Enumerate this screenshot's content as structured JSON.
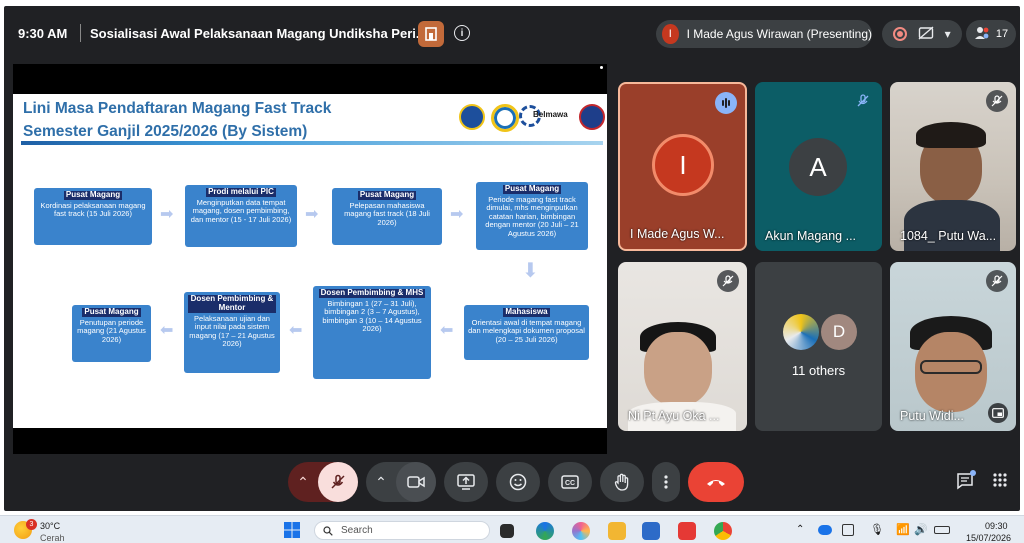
{
  "topbar": {
    "time": "9:30 AM",
    "meeting_title": "Sosialisasi Awal Pelaksanaan Magang Undiksha Peri...",
    "presenter_initial": "I",
    "presenter_label": "I Made Agus Wirawan (Presenting)",
    "people_count": "17"
  },
  "slide": {
    "title_line1": "Lini Masa Pendaftaran Magang Fast Track",
    "title_line2": "Semester Ganjil 2025/2026 (By Sistem)",
    "logo_text": "Belmawa",
    "boxes": [
      {
        "head": "Pusat Magang",
        "body": "Kordinasi pelaksanaan magang fast track (15 Juli 2026)"
      },
      {
        "head": "Prodi melalui PIC",
        "body": "Menginputkan data tempat magang, dosen pembimbing, dan mentor (15 - 17 Juli 2026)"
      },
      {
        "head": "Pusat Magang",
        "body": "Pelepasan mahasiswa magang fast track (18 Juli 2026)"
      },
      {
        "head": "Pusat Magang",
        "body": "Periode magang fast track dimulai, mhs menginputkan catatan harian, bimbingan dengan mentor (20 Juli – 21 Agustus 2026)"
      },
      {
        "head": "Mahasiswa",
        "body": "Orientasi awal di tempat magang dan melengkapi dokumen proposal (20 – 25 Juli 2026)"
      },
      {
        "head": "Dosen Pembimbing & MHS",
        "body": "Bimbingan 1 (27 – 31 Juli), bimbingan 2 (3 – 7 Agustus), bimbingan 3 (10 – 14 Agustus 2026)"
      },
      {
        "head": "Dosen Pembimbing & Mentor",
        "body": "Pelaksanaan ujian dan input nilai pada sistem magang (17 – 21 Agustus 2026)"
      },
      {
        "head": "Pusat Magang",
        "body": "Penutupan periode magang (21 Agustus 2026)"
      }
    ]
  },
  "tiles": [
    {
      "name": "I Made Agus W...",
      "initial": "I"
    },
    {
      "name": "Akun Magang ...",
      "initial": "A"
    },
    {
      "name": "1084_ Putu Wa..."
    },
    {
      "name": "Ni Pt Ayu Oka ..."
    },
    {
      "name": "11 others",
      "initial": "D"
    },
    {
      "name": "Putu Widi..."
    }
  ],
  "taskbar": {
    "weather_temp": "30°C",
    "weather_desc": "Cerah",
    "weather_badge": "3",
    "search_placeholder": "Search",
    "clock_time": "09:30",
    "clock_date": "15/07/2026"
  },
  "colors": {
    "meet_bg": "#202124",
    "control_bg": "#3c4043",
    "end_call": "#ea4335",
    "slide_title": "#2f6fa9",
    "slide_box": "#3a83cc",
    "speaking_border": "#f7b89a"
  }
}
